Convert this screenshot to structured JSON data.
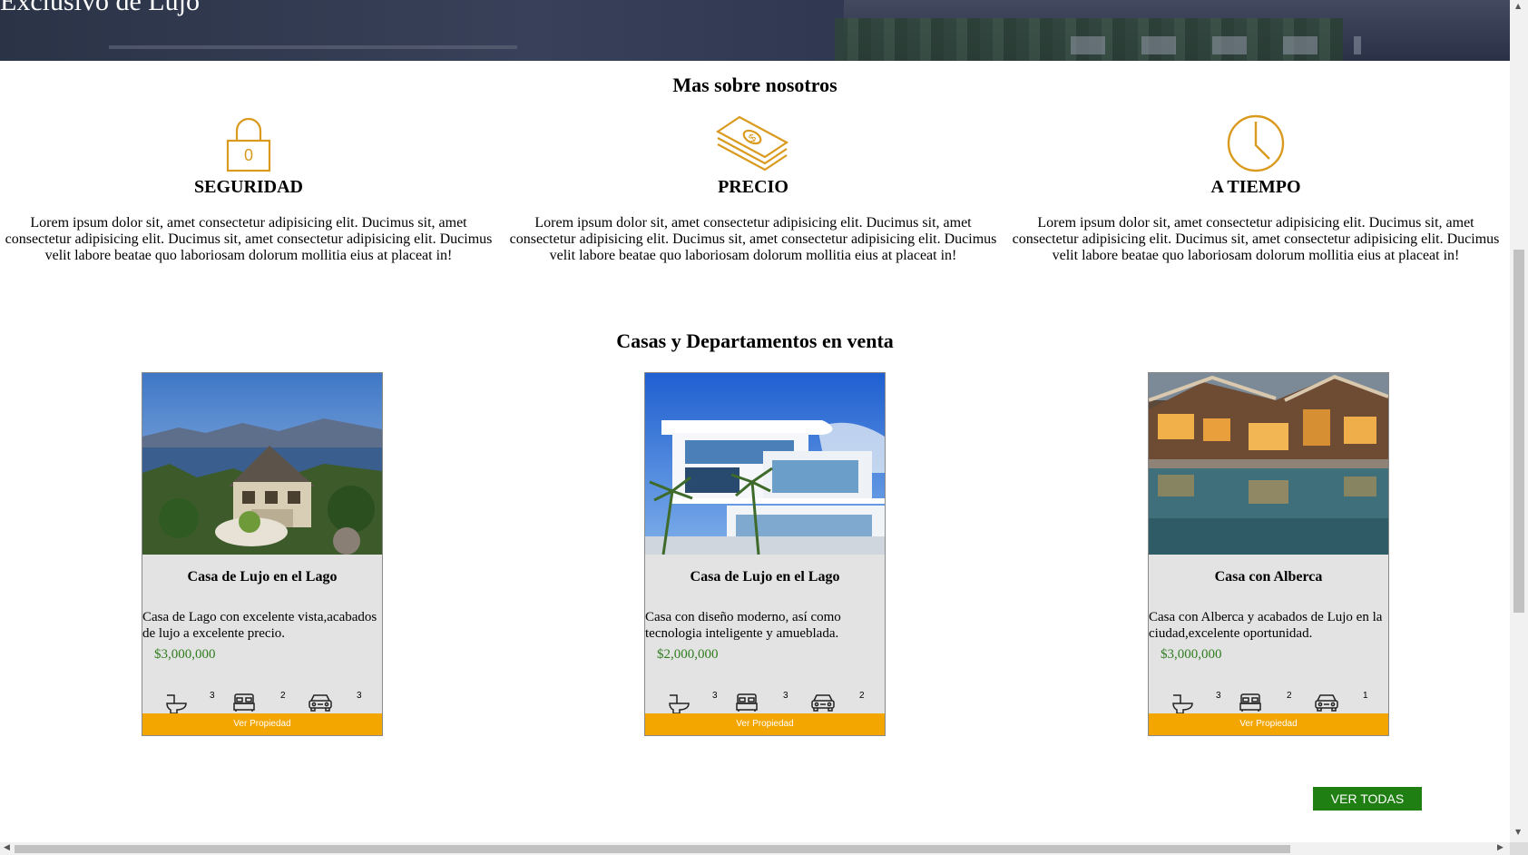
{
  "hero": {
    "title": "Exclusivo de Lujo"
  },
  "about": {
    "heading": "Mas sobre nosotros",
    "features": [
      {
        "icon": "lock-icon",
        "title": "SEGURIDAD",
        "text": "Lorem ipsum dolor sit, amet consectetur adipisicing elit. Ducimus sit, amet consectetur adipisicing elit. Ducimus sit, amet consectetur adipisicing elit. Ducimus velit labore beatae quo laboriosam dolorum mollitia eius at placeat in!"
      },
      {
        "icon": "money-icon",
        "title": "PRECIO",
        "text": "Lorem ipsum dolor sit, amet consectetur adipisicing elit. Ducimus sit, amet consectetur adipisicing elit. Ducimus sit, amet consectetur adipisicing elit. Ducimus velit labore beatae quo laboriosam dolorum mollitia eius at placeat in!"
      },
      {
        "icon": "clock-icon",
        "title": "A TIEMPO",
        "text": "Lorem ipsum dolor sit, amet consectetur adipisicing elit. Ducimus sit, amet consectetur adipisicing elit. Ducimus sit, amet consectetur adipisicing elit. Ducimus velit labore beatae quo laboriosam dolorum mollitia eius at placeat in!"
      }
    ],
    "lock_digit": "0"
  },
  "listings": {
    "heading": "Casas y Departamentos en venta",
    "cards": [
      {
        "title": "Casa de Lujo en el Lago",
        "description": "Casa de Lago con excelente vista,acabados de lujo a excelente precio.",
        "price": "$3,000,000",
        "baths": "3",
        "beds": "2",
        "parking": "3",
        "button": "Ver Propiedad"
      },
      {
        "title": "Casa de Lujo en el Lago",
        "description": "Casa con diseño moderno, así como tecnologia inteligente y amueblada.",
        "price": "$2,000,000",
        "baths": "3",
        "beds": "3",
        "parking": "2",
        "button": "Ver Propiedad"
      },
      {
        "title": "Casa con Alberca",
        "description": "Casa con Alberca y acabados de Lujo en la ciudad,excelente oportunidad.",
        "price": "$3,000,000",
        "baths": "3",
        "beds": "2",
        "parking": "1",
        "button": "Ver Propiedad"
      }
    ],
    "view_all": "VER TODAS"
  },
  "colors": {
    "accent": "#f3a500",
    "icon": "#d99a1e",
    "price": "#2f7d1f",
    "view_all_bg": "#1f7f12",
    "card_bg": "#e3e3e3"
  }
}
